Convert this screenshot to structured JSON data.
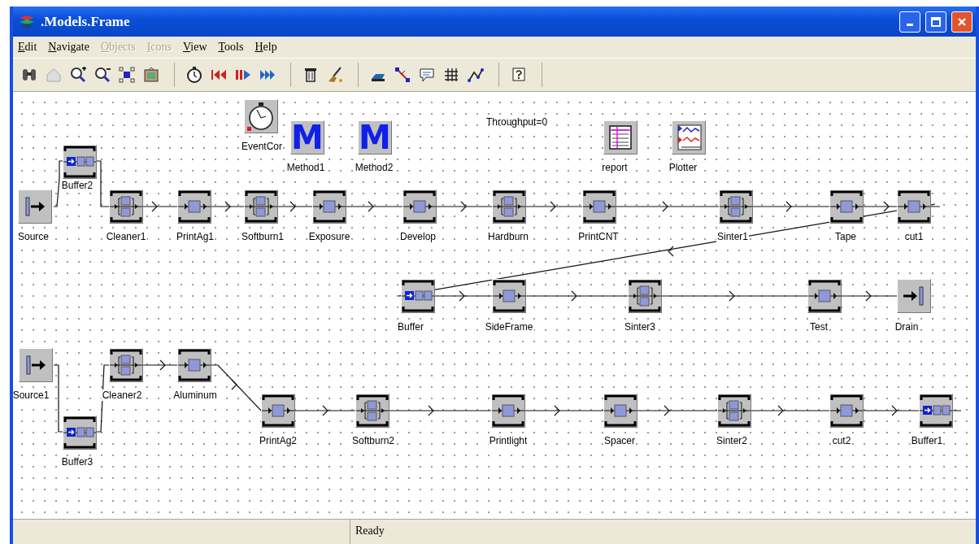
{
  "window": {
    "title": ".Models.Frame"
  },
  "menu": [
    {
      "label": "Edit",
      "disabled": false
    },
    {
      "label": "Navigate",
      "disabled": false
    },
    {
      "label": "Objects",
      "disabled": true
    },
    {
      "label": "Icons",
      "disabled": true
    },
    {
      "label": "View",
      "disabled": false
    },
    {
      "label": "Tools",
      "disabled": false
    },
    {
      "label": "Help",
      "disabled": false
    }
  ],
  "canvas": {
    "comment": "Throughput=0",
    "objects": [
      {
        "label": "EventCor",
        "kind": "event"
      },
      {
        "label": "Method1",
        "kind": "method",
        "icon_text": "M"
      },
      {
        "label": "Method2",
        "kind": "method",
        "icon_text": "M"
      },
      {
        "label": "report",
        "kind": "table"
      },
      {
        "label": "Plotter",
        "kind": "plotter"
      },
      {
        "label": "Buffer2",
        "kind": "buffer"
      },
      {
        "label": "Source",
        "kind": "source"
      },
      {
        "label": "Cleaner1",
        "kind": "parallel"
      },
      {
        "label": "PrintAg1",
        "kind": "single"
      },
      {
        "label": "Softburn1",
        "kind": "parallel"
      },
      {
        "label": "Exposure",
        "kind": "single"
      },
      {
        "label": "Develop",
        "kind": "single"
      },
      {
        "label": "Hardburn",
        "kind": "parallel"
      },
      {
        "label": "PrintCNT",
        "kind": "single"
      },
      {
        "label": "Sinter1",
        "kind": "parallel"
      },
      {
        "label": "Tape",
        "kind": "single"
      },
      {
        "label": "cut1",
        "kind": "single"
      },
      {
        "label": "Buffer",
        "kind": "buffer"
      },
      {
        "label": "SideFrame",
        "kind": "single"
      },
      {
        "label": "Sinter3",
        "kind": "parallel"
      },
      {
        "label": "Test",
        "kind": "single"
      },
      {
        "label": "Drain",
        "kind": "drain"
      },
      {
        "label": "Source1",
        "kind": "source"
      },
      {
        "label": "Cleaner2",
        "kind": "parallel"
      },
      {
        "label": "Aluminum",
        "kind": "single"
      },
      {
        "label": "Buffer3",
        "kind": "buffer"
      },
      {
        "label": "PrintAg2",
        "kind": "single"
      },
      {
        "label": "Softburn2",
        "kind": "parallel"
      },
      {
        "label": "Printlight",
        "kind": "single"
      },
      {
        "label": "Spacer",
        "kind": "single"
      },
      {
        "label": "Sinter2",
        "kind": "parallel"
      },
      {
        "label": "cut2",
        "kind": "single"
      },
      {
        "label": "Buffer1",
        "kind": "buffer"
      }
    ]
  },
  "status_bar": {
    "text": "Ready"
  }
}
